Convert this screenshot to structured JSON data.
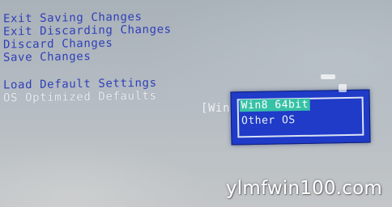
{
  "menu": {
    "items": [
      {
        "label": "Exit Saving Changes"
      },
      {
        "label": "Exit Discarding Changes"
      },
      {
        "label": "Discard Changes"
      },
      {
        "label": "Save Changes"
      },
      {
        "label": "Load Default Settings"
      },
      {
        "label": "OS Optimized Defaults"
      }
    ]
  },
  "os_optimized": {
    "current_value": "[Win"
  },
  "popup": {
    "options": [
      {
        "label": "Win8 64bit",
        "selected": true
      },
      {
        "label": "Other OS",
        "selected": false
      }
    ]
  },
  "watermark": "ylmfwin100.com",
  "colors": {
    "menu_text": "#2f3fb8",
    "popup_bg": "#1f3bc7",
    "selection": "#37c1a6",
    "screen_bg": "#b4bbc2"
  }
}
